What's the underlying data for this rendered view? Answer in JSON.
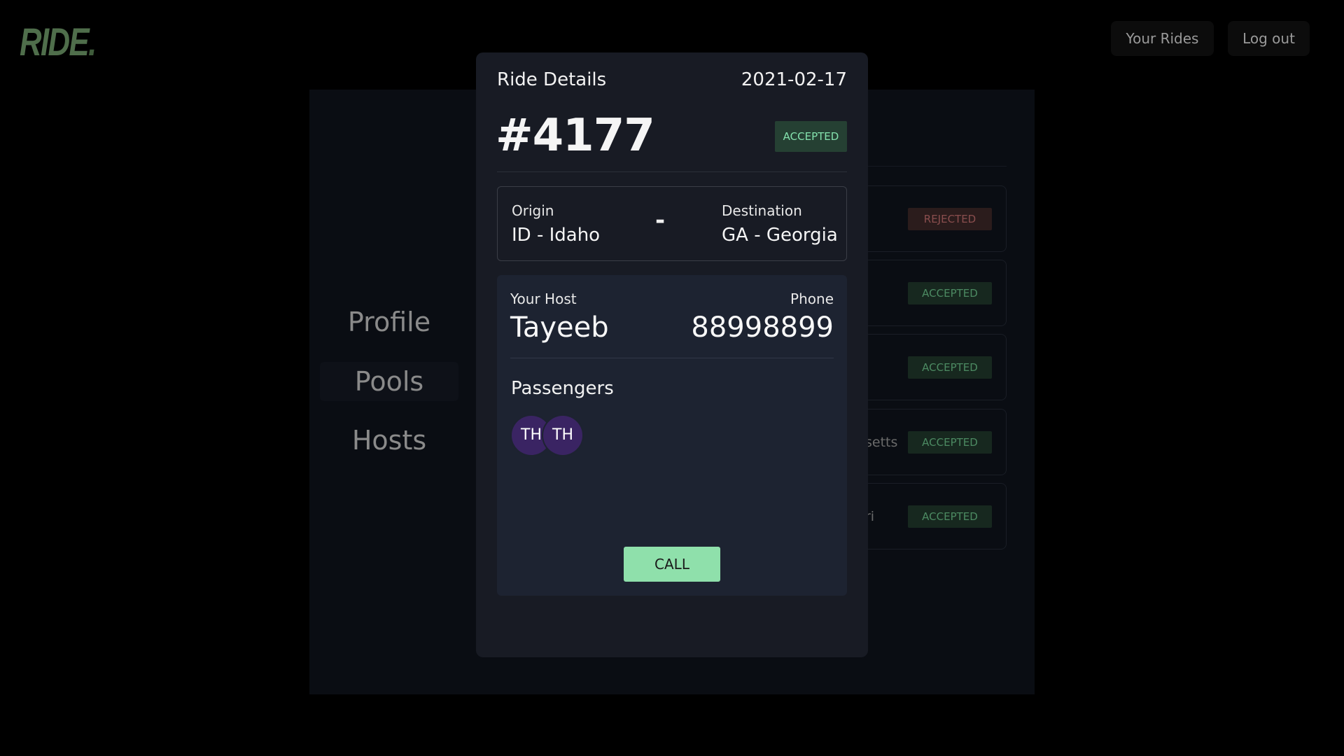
{
  "header": {
    "logo_text": "RIDE",
    "logo_dot": ".",
    "nav": {
      "your_rides": "Your Rides",
      "logout": "Log out"
    }
  },
  "sidebar": {
    "items": [
      {
        "label": "Profile"
      },
      {
        "label": "Pools",
        "active": true
      },
      {
        "label": "Hosts"
      }
    ]
  },
  "background_rides": [
    {
      "text": "",
      "status": "REJECTED"
    },
    {
      "text": "",
      "status": "ACCEPTED"
    },
    {
      "text": "",
      "status": "ACCEPTED"
    },
    {
      "text": "setts",
      "status": "ACCEPTED"
    },
    {
      "text": "ri",
      "status": "ACCEPTED"
    }
  ],
  "modal": {
    "title": "Ride Details",
    "date": "2021-02-17",
    "ride_id": "#4177",
    "status": "ACCEPTED",
    "route": {
      "origin_label": "Origin",
      "origin": "ID - Idaho",
      "separator": "-",
      "destination_label": "Destination",
      "destination": "GA - Georgia"
    },
    "host": {
      "host_label": "Your Host",
      "name": "Tayeeb",
      "phone_label": "Phone",
      "phone": "88998899"
    },
    "passengers": {
      "title": "Passengers",
      "avatars": [
        "TH",
        "TH"
      ]
    },
    "call_label": "CALL"
  },
  "colors": {
    "accent_green": "#8fe0ab",
    "accepted_text": "#84e1ad",
    "rejected_text": "#8a4e4e",
    "avatar_bg": "#3a2463",
    "modal_bg": "#181b24"
  }
}
